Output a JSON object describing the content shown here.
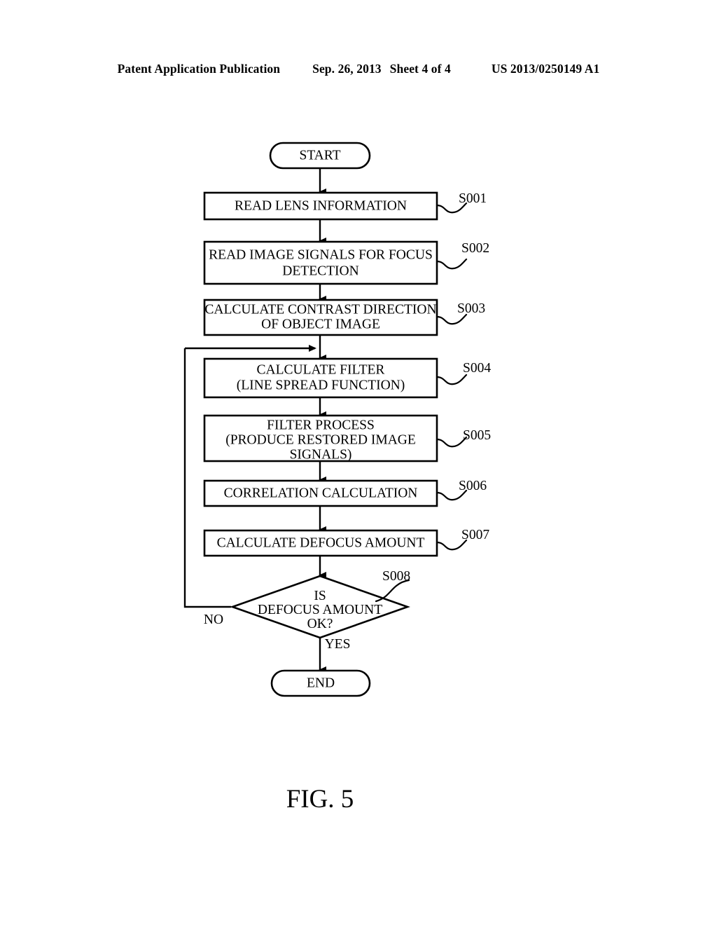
{
  "header": {
    "publication": "Patent Application Publication",
    "date": "Sep. 26, 2013",
    "sheet": "Sheet 4 of 4",
    "patent_number": "US 2013/0250149 A1"
  },
  "figure": {
    "caption": "FIG. 5",
    "terminators": {
      "start": "START",
      "end": "END"
    },
    "steps": [
      {
        "ref": "S001",
        "lines": [
          "READ LENS INFORMATION"
        ]
      },
      {
        "ref": "S002",
        "lines": [
          "READ IMAGE SIGNALS FOR FOCUS",
          "DETECTION"
        ]
      },
      {
        "ref": "S003",
        "lines": [
          "CALCULATE CONTRAST DIRECTION",
          "OF OBJECT IMAGE"
        ]
      },
      {
        "ref": "S004",
        "lines": [
          "CALCULATE FILTER",
          "(LINE SPREAD FUNCTION)"
        ]
      },
      {
        "ref": "S005",
        "lines": [
          "FILTER PROCESS",
          "(PRODUCE RESTORED IMAGE",
          "SIGNALS)"
        ]
      },
      {
        "ref": "S006",
        "lines": [
          "CORRELATION CALCULATION"
        ]
      },
      {
        "ref": "S007",
        "lines": [
          "CALCULATE DEFOCUS AMOUNT"
        ]
      }
    ],
    "decision": {
      "ref": "S008",
      "lines": [
        "IS",
        "DEFOCUS AMOUNT",
        "OK?"
      ],
      "branch_no": "NO",
      "branch_yes": "YES"
    }
  }
}
